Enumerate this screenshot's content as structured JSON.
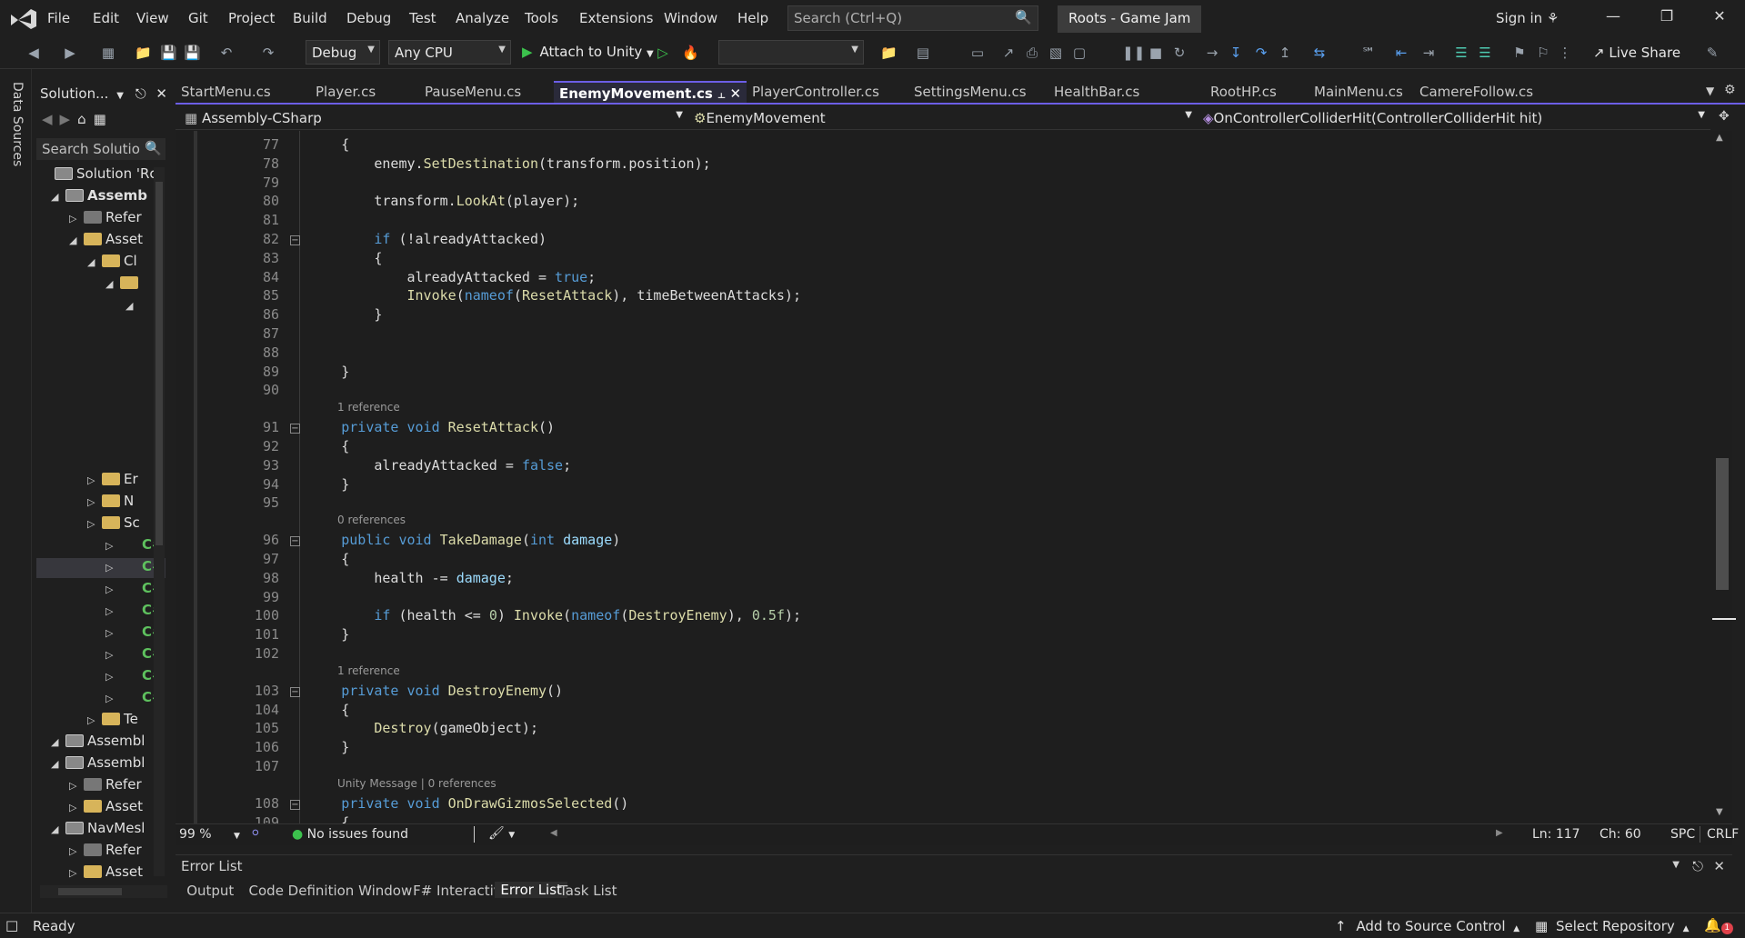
{
  "menu": [
    "File",
    "Edit",
    "View",
    "Git",
    "Project",
    "Build",
    "Debug",
    "Test",
    "Analyze",
    "Tools",
    "Extensions",
    "Window",
    "Help"
  ],
  "search_placeholder": "Search (Ctrl+Q)",
  "solution_title": "Roots - Game Jam",
  "signin": "Sign in",
  "toolbar": {
    "config": "Debug",
    "platform": "Any CPU",
    "attach": "Attach to Unity",
    "liveshare": "Live Share"
  },
  "datasources": "Data Sources",
  "solution_panel": {
    "header": "Solution...",
    "search": "Search Solutio"
  },
  "tree": [
    {
      "label": "Solution 'Rc",
      "kind": "solution"
    },
    {
      "label": "Assemb",
      "kind": "project",
      "bold": true
    },
    {
      "label": "Refer",
      "kind": "ref"
    },
    {
      "label": "Asset",
      "kind": "folder"
    },
    {
      "label": "Cl",
      "kind": "folder"
    },
    {
      "label": "",
      "kind": "folder"
    },
    {
      "label": "",
      "kind": "empty"
    },
    {
      "label": "Er",
      "kind": "folder"
    },
    {
      "label": "N",
      "kind": "folder"
    },
    {
      "label": "Sc",
      "kind": "folder"
    },
    {
      "label": "C#",
      "kind": "cs"
    },
    {
      "label": "C#",
      "kind": "cs"
    },
    {
      "label": "C#",
      "kind": "cs"
    },
    {
      "label": "C#",
      "kind": "cs"
    },
    {
      "label": "C#",
      "kind": "cs"
    },
    {
      "label": "C#",
      "kind": "cs"
    },
    {
      "label": "C#",
      "kind": "cs"
    },
    {
      "label": "C#",
      "kind": "cs"
    },
    {
      "label": "Te",
      "kind": "folder"
    },
    {
      "label": "Assembl",
      "kind": "project"
    },
    {
      "label": "Assembl",
      "kind": "project"
    },
    {
      "label": "Refer",
      "kind": "ref"
    },
    {
      "label": "Asset",
      "kind": "folder"
    },
    {
      "label": "NavMesl",
      "kind": "project"
    },
    {
      "label": "Refer",
      "kind": "ref"
    },
    {
      "label": "Asset",
      "kind": "folder"
    }
  ],
  "tabs": [
    "StartMenu.cs",
    "Player.cs",
    "PauseMenu.cs",
    "EnemyMovement.cs",
    "PlayerController.cs",
    "SettingsMenu.cs",
    "HealthBar.cs",
    "RootHP.cs",
    "MainMenu.cs",
    "CamereFollow.cs"
  ],
  "active_tab": "EnemyMovement.cs",
  "navbar": {
    "project": "Assembly-CSharp",
    "class": "EnemyMovement",
    "member": "OnControllerColliderHit(ControllerColliderHit hit)"
  },
  "code_lines": [
    {
      "n": "77",
      "t": "        {"
    },
    {
      "n": "78",
      "t": "            enemy.SetDestination(transform.position);"
    },
    {
      "n": "79",
      "t": ""
    },
    {
      "n": "80",
      "t": "            transform.LookAt(player);"
    },
    {
      "n": "81",
      "t": ""
    },
    {
      "n": "82",
      "t": "            if (!alreadyAttacked)"
    },
    {
      "n": "83",
      "t": "            {"
    },
    {
      "n": "84",
      "t": "                alreadyAttacked = true;"
    },
    {
      "n": "85",
      "t": "                Invoke(nameof(ResetAttack), timeBetweenAttacks);"
    },
    {
      "n": "86",
      "t": "            }"
    },
    {
      "n": "87",
      "t": ""
    },
    {
      "n": "88",
      "t": ""
    },
    {
      "n": "89",
      "t": "        }"
    },
    {
      "n": "90",
      "t": ""
    },
    {
      "n": "91",
      "t": "        private void ResetAttack()",
      "lens": "1 reference"
    },
    {
      "n": "92",
      "t": "        {"
    },
    {
      "n": "93",
      "t": "            alreadyAttacked = false;"
    },
    {
      "n": "94",
      "t": "        }"
    },
    {
      "n": "95",
      "t": ""
    },
    {
      "n": "96",
      "t": "        public void TakeDamage(int damage)",
      "lens": "0 references"
    },
    {
      "n": "97",
      "t": "        {"
    },
    {
      "n": "98",
      "t": "            health -= damage;"
    },
    {
      "n": "99",
      "t": ""
    },
    {
      "n": "100",
      "t": "            if (health <= 0) Invoke(nameof(DestroyEnemy), 0.5f);"
    },
    {
      "n": "101",
      "t": "        }"
    },
    {
      "n": "102",
      "t": ""
    },
    {
      "n": "103",
      "t": "        private void DestroyEnemy()",
      "lens": "1 reference"
    },
    {
      "n": "104",
      "t": "        {"
    },
    {
      "n": "105",
      "t": "            Destroy(gameObject);"
    },
    {
      "n": "106",
      "t": "        }"
    },
    {
      "n": "107",
      "t": ""
    },
    {
      "n": "108",
      "t": "        private void OnDrawGizmosSelected()",
      "lens": "Unity Message | 0 references"
    },
    {
      "n": "109",
      "t": "        {"
    }
  ],
  "status_row": {
    "zoom": "99 %",
    "issues": "No issues found",
    "ln": "Ln: 117",
    "ch": "Ch: 60",
    "spc": "SPC",
    "crlf": "CRLF"
  },
  "error_list": "Error List",
  "bottom_tabs": [
    "Output",
    "Code Definition Window",
    "F# Interactive",
    "Error List",
    "Task List"
  ],
  "statusbar": {
    "ready": "Ready",
    "source": "Add to Source Control",
    "repo": "Select Repository",
    "notif_count": "1"
  }
}
